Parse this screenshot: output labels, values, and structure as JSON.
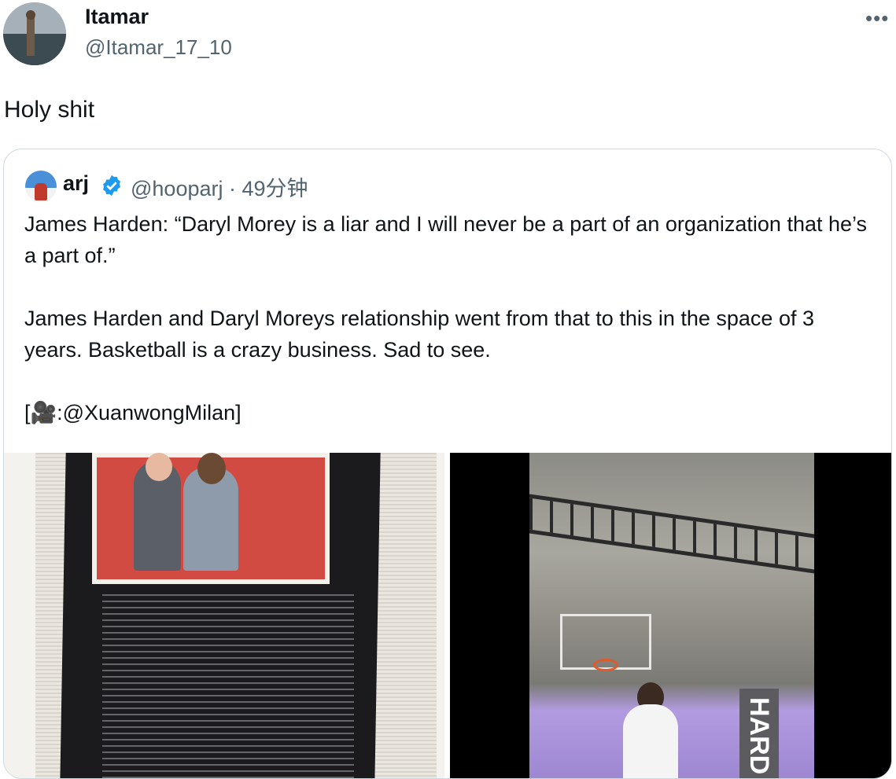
{
  "tweet": {
    "author_name": "Itamar",
    "author_handle": "@Itamar_17_10",
    "more_icon": "more-horizontal-icon",
    "text": "Holy shit"
  },
  "quote": {
    "author_name": "arj",
    "verified_icon": "verified-badge-icon",
    "handle": "@hooparj",
    "separator": "·",
    "time": "49分钟",
    "paragraphs": [
      "James Harden: “Daryl Morey is a liar and I will never be a part of an organization that he’s a part of.”",
      "James Harden and Daryl Moreys relationship went from that to this in the space of 3 years. Basketball is a crazy business. Sad to see.",
      "[🎥:@XuanwongMilan]"
    ]
  },
  "media": {
    "right_banner_text": "HARD"
  },
  "colors": {
    "text": "#0f1419",
    "secondary_text": "#536471",
    "border": "#cfd9de",
    "verified": "#1d9bf0"
  }
}
